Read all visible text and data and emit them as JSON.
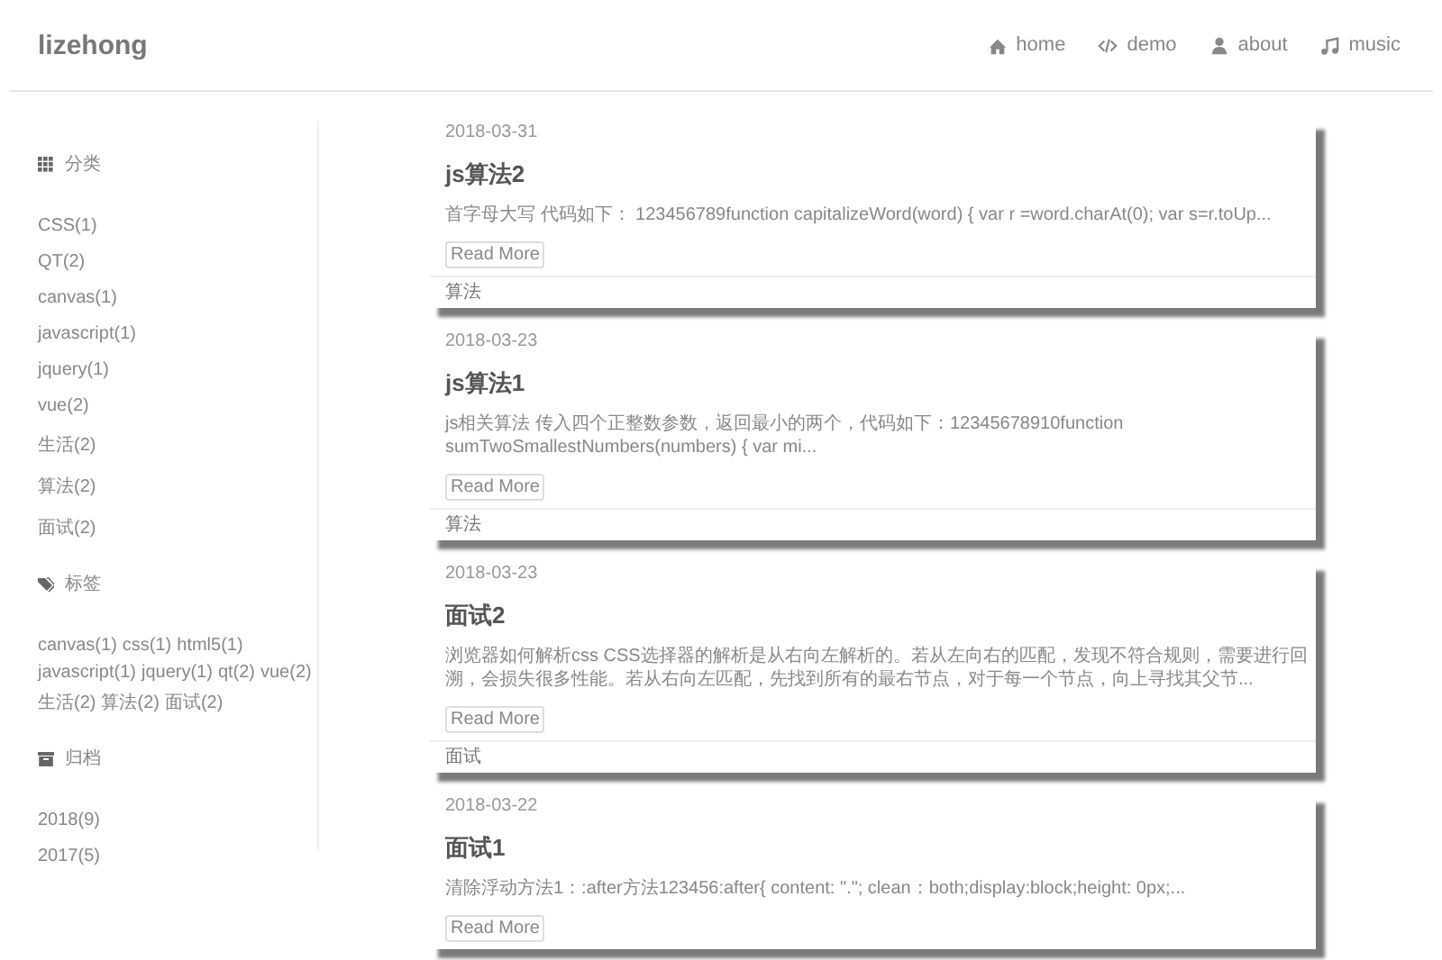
{
  "header": {
    "brand": "lizehong",
    "nav": [
      {
        "label": "home"
      },
      {
        "label": "demo"
      },
      {
        "label": "about"
      },
      {
        "label": "music"
      }
    ]
  },
  "sidebar": {
    "categories": {
      "title": "分类",
      "items": [
        "CSS(1)",
        "QT(2)",
        "canvas(1)",
        "javascript(1)",
        "jquery(1)",
        "vue(2)",
        "生活(2)",
        "算法(2)",
        "面试(2)"
      ]
    },
    "tags": {
      "title": "标签",
      "items": [
        "canvas(1)",
        "css(1)",
        "html5(1)",
        "javascript(1)",
        "jquery(1)",
        "qt(2)",
        "vue(2)",
        "生活(2)",
        "算法(2)",
        "面试(2)"
      ]
    },
    "archive": {
      "title": "归档",
      "items": [
        "2018(9)",
        "2017(5)"
      ]
    }
  },
  "posts": [
    {
      "date": "2018-03-31",
      "title": "js算法2",
      "excerpt": "首字母大写 代码如下： 123456789function capitalizeWord(word) { var r =word.charAt(0); var s=r.toUp...",
      "button": "Read More",
      "category": "算法"
    },
    {
      "date": "2018-03-23",
      "title": "js算法1",
      "excerpt": "js相关算法 传入四个正整数参数，返回最小的两个，代码如下：12345678910function sumTwoSmallestNumbers(numbers) { var mi...",
      "button": "Read More",
      "category": "算法"
    },
    {
      "date": "2018-03-23",
      "title": "面试2",
      "excerpt": "浏览器如何解析css CSS选择器的解析是从右向左解析的。若从左向右的匹配，发现不符合规则，需要进行回溯，会损失很多性能。若从右向左匹配，先找到所有的最右节点，对于每一个节点，向上寻找其父节...",
      "button": "Read More",
      "category": "面试"
    },
    {
      "date": "2018-03-22",
      "title": "面试1",
      "excerpt": "清除浮动方法1：:after方法123456:after{ content: \".\"; clean：both;display:block;height: 0px;...",
      "button": "Read More"
    }
  ]
}
